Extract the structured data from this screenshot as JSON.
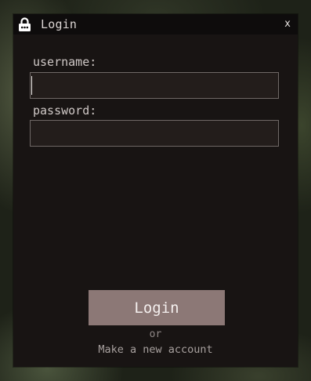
{
  "window": {
    "title": "Login",
    "close_label": "x"
  },
  "form": {
    "username_label": "username:",
    "username_value": "",
    "password_label": "password:",
    "password_value": ""
  },
  "actions": {
    "login_label": "Login",
    "or_text": "or",
    "new_account_label": "Make a new account"
  },
  "icons": {
    "titlebar_icon": "lock-icon"
  },
  "colors": {
    "window_bg": "#181413",
    "titlebar_bg": "#0e0c0c",
    "button_bg": "#8c7876",
    "field_bg": "#231d1b",
    "field_border": "#6f6866"
  }
}
